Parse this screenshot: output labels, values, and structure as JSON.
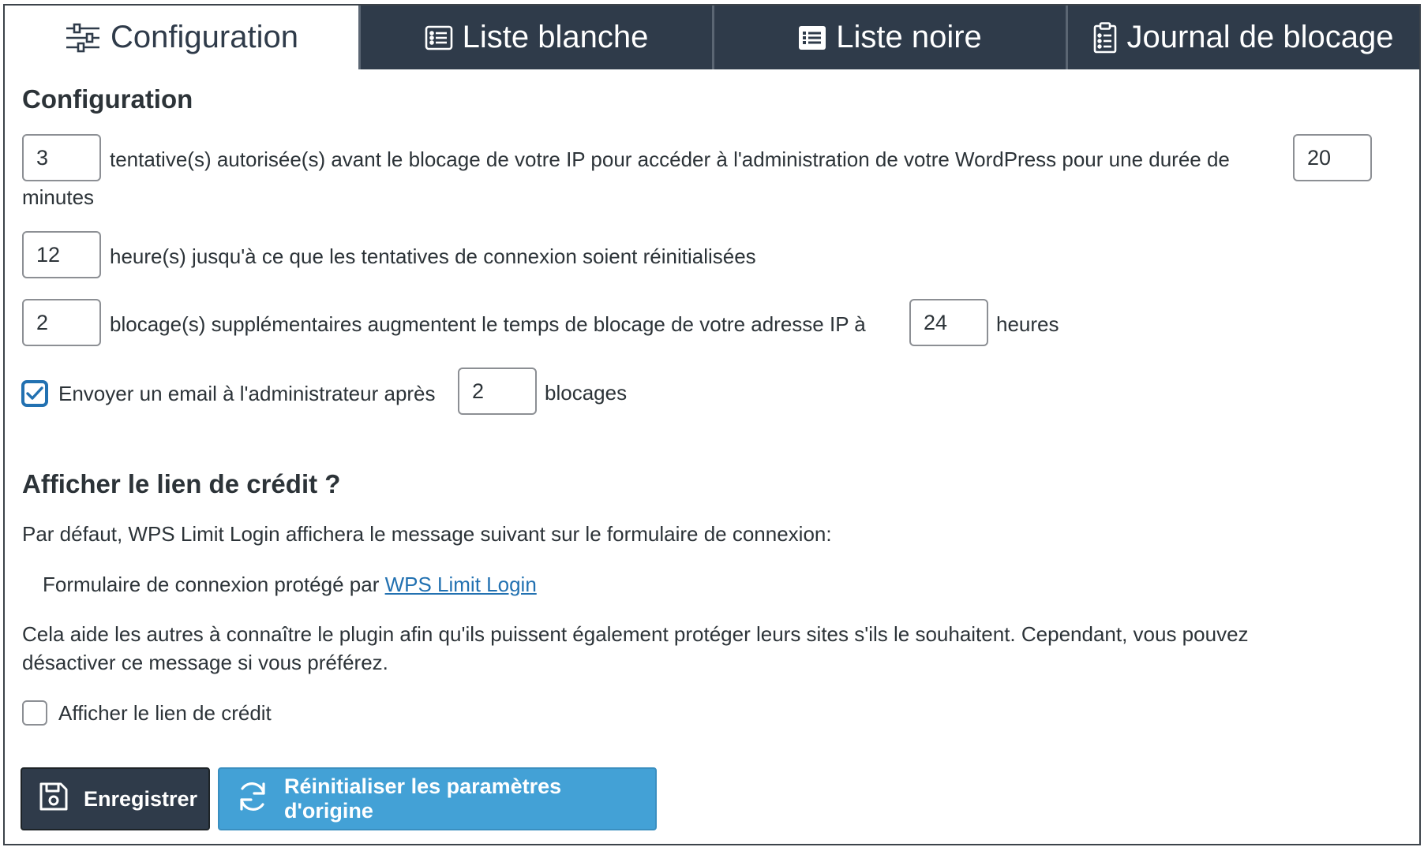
{
  "tabs": [
    {
      "label": "Configuration",
      "icon": "sliders-icon",
      "active": true
    },
    {
      "label": "Liste blanche",
      "icon": "list-icon",
      "active": false
    },
    {
      "label": "Liste noire",
      "icon": "list-solid-icon",
      "active": false
    },
    {
      "label": "Journal de blocage",
      "icon": "clipboard-list-icon",
      "active": false
    }
  ],
  "colors": {
    "tab_dark": "#2f3b4a",
    "accent_blue": "#2271b1",
    "reset_button": "#43a1d6",
    "text": "#2c3338"
  },
  "config": {
    "title": "Configuration",
    "attempts": {
      "value": "3",
      "text": "tentative(s) autorisée(s) avant le blocage de votre IP pour accéder à l'administration de votre WordPress pour une durée de"
    },
    "duration": {
      "value": "20",
      "unit": "minutes"
    },
    "reset_hours": {
      "value": "12",
      "text": "heure(s) jusqu'à ce que les tentatives de connexion soient réinitialisées"
    },
    "extra_lockouts": {
      "value": "2",
      "text": "blocage(s) supplémentaires augmentent le temps de blocage de votre adresse IP à"
    },
    "extra_hours": {
      "value": "24",
      "unit": "heures"
    },
    "email": {
      "checked": true,
      "label": "Envoyer un email à l'administrateur après",
      "value": "2",
      "unit": "blocages"
    }
  },
  "credit": {
    "title": "Afficher le lien de crédit ?",
    "intro": "Par défaut, WPS Limit Login affichera le message suivant sur le formulaire de connexion:",
    "sample_prefix": "Formulaire de connexion protégé par",
    "sample_link": "WPS Limit Login",
    "explain_line1": "Cela aide les autres à connaître le plugin afin qu'ils puissent également protéger leurs sites s'ils le souhaitent. Cependant, vous pouvez",
    "explain_line2": "désactiver ce message si vous préférez.",
    "checkbox_label": "Afficher le lien de crédit",
    "checked": false
  },
  "buttons": {
    "save": {
      "label": "Enregistrer",
      "icon": "floppy-disk-icon"
    },
    "reset": {
      "label": "Réinitialiser les paramètres d'origine",
      "icon": "refresh-icon"
    }
  }
}
